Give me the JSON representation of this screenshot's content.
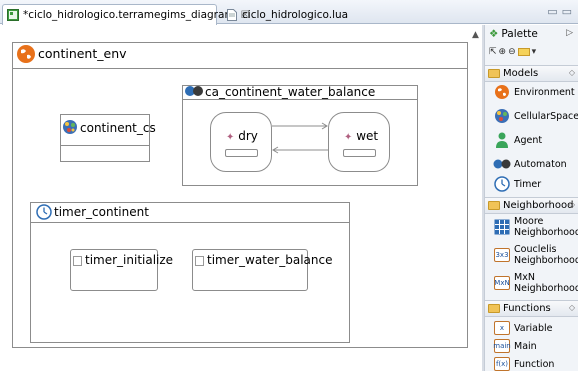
{
  "tabs": [
    {
      "label": "*ciclo_hidrologico.terramegims_diagram",
      "close": "☒",
      "active": true
    },
    {
      "label": "ciclo_hidrologico.lua",
      "active": false
    }
  ],
  "window_controls": {
    "minimize": "▭",
    "maximize": "▭"
  },
  "diagram": {
    "environment": {
      "label": "continent_env"
    },
    "cellular_space": {
      "label": "continent_cs"
    },
    "automaton": {
      "label": "ca_continent_water_balance",
      "states": [
        {
          "label": "dry"
        },
        {
          "label": "wet"
        }
      ]
    },
    "timer": {
      "label": "timer_continent",
      "functions": [
        {
          "label": "timer_initialize"
        },
        {
          "label": "timer_water_balance"
        }
      ]
    }
  },
  "palette": {
    "title": "Palette",
    "sections": [
      {
        "label": "Models",
        "items": [
          "Environment",
          "CellularSpace",
          "Agent",
          "Automaton",
          "Timer"
        ]
      },
      {
        "label": "Neighborhood",
        "items": [
          "Moore Neighborhood",
          "Couclelis Neighborhood",
          "MxN Neighborhood"
        ]
      },
      {
        "label": "Functions",
        "items": [
          "Variable",
          "Main",
          "Function"
        ]
      }
    ],
    "mini_icons": {
      "couclelis": "3x3",
      "mxn": "MxN",
      "variable": "x",
      "main": "main",
      "function": "f(x)"
    }
  },
  "colors": {
    "accent": "#1a4f9a",
    "env_orange": "#e8711a",
    "tab_border": "#a9b7c9"
  }
}
